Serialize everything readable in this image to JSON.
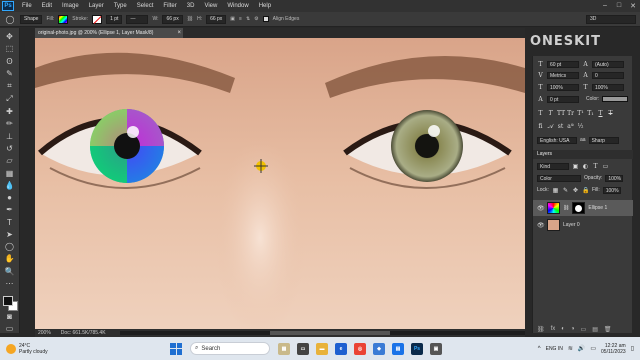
{
  "menubar": {
    "logo": "Ps",
    "items": [
      "File",
      "Edit",
      "Image",
      "Layer",
      "Type",
      "Select",
      "Filter",
      "3D",
      "View",
      "Window",
      "Help"
    ],
    "window_buttons": [
      "–",
      "□",
      "✕"
    ]
  },
  "options": {
    "mode": "Shape",
    "fill_label": "Fill:",
    "stroke_label": "Stroke:",
    "stroke_size": "1 pt",
    "w_label": "W:",
    "w_value": "66 px",
    "h_label": "H:",
    "h_value": "66 px",
    "align_edges": "Align Edges",
    "workspace": "3D"
  },
  "document": {
    "tab_title": "original-photo.jpg @ 200% (Ellipse 1, Layer Mask/8)",
    "tab_close": "×",
    "zoom": "200%",
    "doc_info": "Doc: 661.5K/785.4K"
  },
  "watermark": "ONESKIT",
  "character": {
    "font_size": "60 pt",
    "leading": "(Auto)",
    "kerning": "Metrics",
    "tracking": "0",
    "vscale": "100%",
    "hscale": "100%",
    "baseline": "0 pt",
    "color_label": "Color:",
    "language": "English: USA",
    "aa_icon": "aa",
    "aa_mode": "Sharp",
    "glyphs": [
      "T",
      "T",
      "TT",
      "Tr",
      "T¹",
      "T₁",
      "T",
      "T"
    ]
  },
  "layers": {
    "tab": "Layers",
    "kind": "Kind",
    "blend_mode": "Color",
    "opacity_label": "Opacity:",
    "opacity": "100%",
    "lock_label": "Lock:",
    "fill_label": "Fill:",
    "fill": "100%",
    "items": [
      {
        "name": "Ellipse 1",
        "selected": true
      },
      {
        "name": "Layer 0",
        "selected": false
      }
    ],
    "bottom_icons": [
      "⛓",
      "fx",
      "◐",
      "◑",
      "▭",
      "▤",
      "🗑"
    ]
  },
  "taskbar": {
    "temp": "24°C",
    "weather": "Partly cloudy",
    "search": "Search",
    "time": "12:22 am",
    "date": "05/11/2023",
    "lang": "ENG IN"
  },
  "colors": {
    "accent": "#31a8ff",
    "panel": "#3a3a3a",
    "dark": "#282828"
  }
}
